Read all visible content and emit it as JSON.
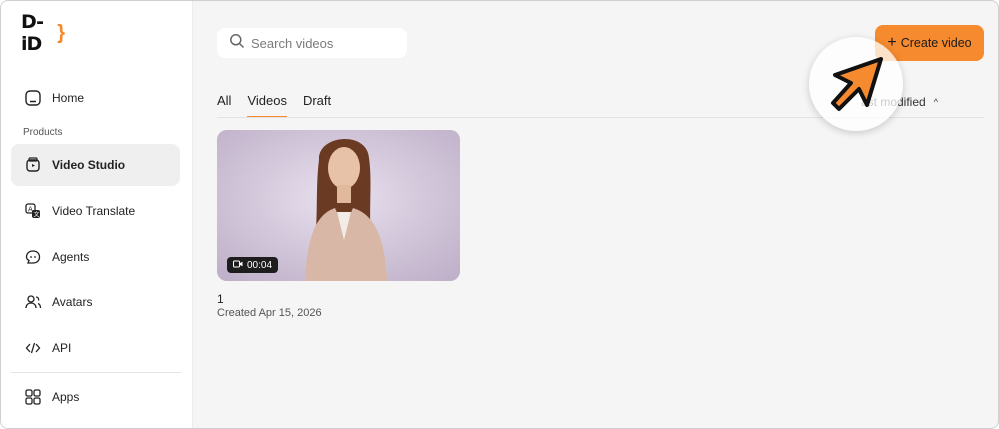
{
  "app": {
    "logo_text": "D-iD",
    "brand_color": "#f68a2e"
  },
  "sidebar": {
    "home": {
      "label": "Home",
      "icon": "home-icon"
    },
    "section_label": "Products",
    "items": [
      {
        "label": "Video Studio",
        "icon": "video-studio-icon",
        "active": true
      },
      {
        "label": "Video Translate",
        "icon": "translate-icon"
      },
      {
        "label": "Agents",
        "icon": "agents-icon"
      },
      {
        "label": "Avatars",
        "icon": "avatars-icon"
      },
      {
        "label": "API",
        "icon": "code-icon"
      }
    ],
    "apps": {
      "label": "Apps",
      "icon": "apps-grid-icon"
    }
  },
  "search": {
    "placeholder": "Search videos",
    "value": ""
  },
  "toolbar": {
    "create_label": "Create video"
  },
  "tabs": [
    {
      "label": "All"
    },
    {
      "label": "Videos",
      "active": true
    },
    {
      "label": "Draft"
    }
  ],
  "sort": {
    "label": "ast modified"
  },
  "videos": [
    {
      "title": "1",
      "created": "Created Apr 15, 2026",
      "duration": "00:04"
    }
  ]
}
